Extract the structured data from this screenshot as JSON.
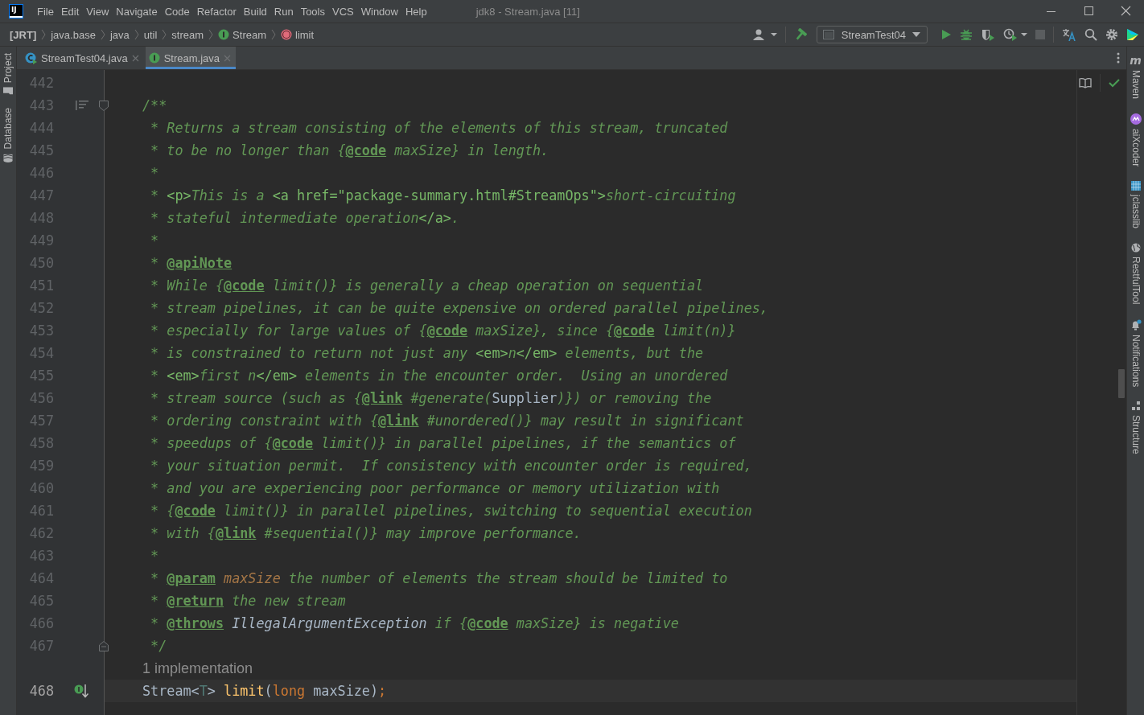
{
  "window": {
    "logo": "IJ",
    "title": "jdk8 - Stream.java [11]"
  },
  "menu": [
    "File",
    "Edit",
    "View",
    "Navigate",
    "Code",
    "Refactor",
    "Build",
    "Run",
    "Tools",
    "VCS",
    "Window",
    "Help"
  ],
  "breadcrumbs": [
    {
      "label": "[JRT]",
      "kind": "root"
    },
    {
      "label": "java.base",
      "kind": "package"
    },
    {
      "label": "java",
      "kind": "package"
    },
    {
      "label": "util",
      "kind": "package"
    },
    {
      "label": "stream",
      "kind": "package"
    },
    {
      "label": "Stream",
      "kind": "interface"
    },
    {
      "label": "limit",
      "kind": "method"
    }
  ],
  "run_configuration": {
    "label": "StreamTest04"
  },
  "tabs": [
    {
      "label": "StreamTest04.java",
      "kind": "class",
      "selected": false
    },
    {
      "label": "Stream.java",
      "kind": "interface",
      "selected": true
    }
  ],
  "left_tool_windows": [
    {
      "label": "Project",
      "kind": "folder"
    },
    {
      "label": "Database",
      "kind": "database"
    }
  ],
  "right_tool_windows": [
    {
      "label": "Maven",
      "kind": "maven",
      "glyph": "m"
    },
    {
      "label": "aiXcoder",
      "kind": "aixcoder"
    },
    {
      "label": "jclasslib",
      "kind": "jclasslib"
    },
    {
      "label": "RestfulTool",
      "kind": "globe"
    },
    {
      "label": "Notifications",
      "kind": "notifications"
    },
    {
      "label": "Structure",
      "kind": "structure"
    }
  ],
  "editor": {
    "lines": [
      {
        "kind": "code",
        "number": "442",
        "current": false
      },
      {
        "kind": "code",
        "number": "443",
        "current": false,
        "doc_toggle": true,
        "fold_start": true,
        "segments": [
          {
            "kind": "text",
            "text": "/**"
          }
        ]
      },
      {
        "kind": "code",
        "number": "444",
        "current": false,
        "segments": [
          {
            "kind": "text",
            "text": " * Returns a stream consisting of the elements of this stream, truncated"
          }
        ]
      },
      {
        "kind": "code",
        "number": "445",
        "current": false,
        "segments": [
          {
            "kind": "text",
            "text": " * to be no longer than {"
          },
          {
            "kind": "tag",
            "text": "@code"
          },
          {
            "kind": "text",
            "text": " maxSize} in length."
          }
        ]
      },
      {
        "kind": "code",
        "number": "446",
        "current": false,
        "segments": [
          {
            "kind": "text",
            "text": " *"
          }
        ]
      },
      {
        "kind": "code",
        "number": "447",
        "current": false,
        "segments": [
          {
            "kind": "text",
            "text": " * "
          },
          {
            "kind": "markup",
            "text": "<p>"
          },
          {
            "kind": "text",
            "text": "This is a "
          },
          {
            "kind": "markup",
            "text": "<a href=\"package-summary.html#StreamOps\">"
          },
          {
            "kind": "text",
            "text": "short-circuiting"
          }
        ]
      },
      {
        "kind": "code",
        "number": "448",
        "current": false,
        "segments": [
          {
            "kind": "text",
            "text": " * stateful intermediate operation"
          },
          {
            "kind": "markup",
            "text": "</a>"
          },
          {
            "kind": "text",
            "text": "."
          }
        ]
      },
      {
        "kind": "code",
        "number": "449",
        "current": false,
        "segments": [
          {
            "kind": "text",
            "text": " *"
          }
        ]
      },
      {
        "kind": "code",
        "number": "450",
        "current": false,
        "segments": [
          {
            "kind": "text",
            "text": " * "
          },
          {
            "kind": "tag",
            "text": "@apiNote"
          }
        ]
      },
      {
        "kind": "code",
        "number": "451",
        "current": false,
        "segments": [
          {
            "kind": "text",
            "text": " * While {"
          },
          {
            "kind": "tag",
            "text": "@code"
          },
          {
            "kind": "text",
            "text": " limit()} is generally a cheap operation on sequential"
          }
        ]
      },
      {
        "kind": "code",
        "number": "452",
        "current": false,
        "segments": [
          {
            "kind": "text",
            "text": " * stream pipelines, it can be quite expensive on ordered parallel pipelines,"
          }
        ]
      },
      {
        "kind": "code",
        "number": "453",
        "current": false,
        "segments": [
          {
            "kind": "text",
            "text": " * especially for large values of {"
          },
          {
            "kind": "tag",
            "text": "@code"
          },
          {
            "kind": "text",
            "text": " maxSize}, since {"
          },
          {
            "kind": "tag",
            "text": "@code"
          },
          {
            "kind": "text",
            "text": " limit(n)}"
          }
        ]
      },
      {
        "kind": "code",
        "number": "454",
        "current": false,
        "segments": [
          {
            "kind": "text",
            "text": " * is constrained to return not just any "
          },
          {
            "kind": "markup",
            "text": "<em>"
          },
          {
            "kind": "text",
            "text": "n"
          },
          {
            "kind": "markup",
            "text": "</em>"
          },
          {
            "kind": "text",
            "text": " elements, but the"
          }
        ]
      },
      {
        "kind": "code",
        "number": "455",
        "current": false,
        "segments": [
          {
            "kind": "text",
            "text": " * "
          },
          {
            "kind": "markup",
            "text": "<em>"
          },
          {
            "kind": "text",
            "text": "first n"
          },
          {
            "kind": "markup",
            "text": "</em>"
          },
          {
            "kind": "text",
            "text": " elements in the encounter order.  Using an unordered"
          }
        ]
      },
      {
        "kind": "code",
        "number": "456",
        "current": false,
        "segments": [
          {
            "kind": "text",
            "text": " * stream source (such as {"
          },
          {
            "kind": "tag",
            "text": "@link"
          },
          {
            "kind": "text",
            "text": " #generate("
          },
          {
            "kind": "type",
            "text": "Supplier"
          },
          {
            "kind": "text",
            "text": ")}) or removing the"
          }
        ]
      },
      {
        "kind": "code",
        "number": "457",
        "current": false,
        "segments": [
          {
            "kind": "text",
            "text": " * ordering constraint with {"
          },
          {
            "kind": "tag",
            "text": "@link"
          },
          {
            "kind": "text",
            "text": " #unordered()} may result in significant"
          }
        ]
      },
      {
        "kind": "code",
        "number": "458",
        "current": false,
        "segments": [
          {
            "kind": "text",
            "text": " * speedups of {"
          },
          {
            "kind": "tag",
            "text": "@code"
          },
          {
            "kind": "text",
            "text": " limit()} in parallel pipelines, if the semantics of"
          }
        ]
      },
      {
        "kind": "code",
        "number": "459",
        "current": false,
        "segments": [
          {
            "kind": "text",
            "text": " * your situation permit.  If consistency with encounter order is required,"
          }
        ]
      },
      {
        "kind": "code",
        "number": "460",
        "current": false,
        "segments": [
          {
            "kind": "text",
            "text": " * and you are experiencing poor performance or memory utilization with"
          }
        ]
      },
      {
        "kind": "code",
        "number": "461",
        "current": false,
        "segments": [
          {
            "kind": "text",
            "text": " * {"
          },
          {
            "kind": "tag",
            "text": "@code"
          },
          {
            "kind": "text",
            "text": " limit()} in parallel pipelines, switching to sequential execution"
          }
        ]
      },
      {
        "kind": "code",
        "number": "462",
        "current": false,
        "segments": [
          {
            "kind": "text",
            "text": " * with {"
          },
          {
            "kind": "tag",
            "text": "@link"
          },
          {
            "kind": "text",
            "text": " #sequential()} may improve performance."
          }
        ]
      },
      {
        "kind": "code",
        "number": "463",
        "current": false,
        "segments": [
          {
            "kind": "text",
            "text": " *"
          }
        ]
      },
      {
        "kind": "code",
        "number": "464",
        "current": false,
        "segments": [
          {
            "kind": "text",
            "text": " * "
          },
          {
            "kind": "tag",
            "text": "@param"
          },
          {
            "kind": "parameter",
            "text": " maxSize"
          },
          {
            "kind": "text",
            "text": " the number of elements the stream should be limited to"
          }
        ]
      },
      {
        "kind": "code",
        "number": "465",
        "current": false,
        "segments": [
          {
            "kind": "text",
            "text": " * "
          },
          {
            "kind": "tag",
            "text": "@return"
          },
          {
            "kind": "text",
            "text": " the new stream"
          }
        ]
      },
      {
        "kind": "code",
        "number": "466",
        "current": false,
        "segments": [
          {
            "kind": "text",
            "text": " * "
          },
          {
            "kind": "tag",
            "text": "@throws"
          },
          {
            "kind": "exception",
            "text": " IllegalArgumentException"
          },
          {
            "kind": "text",
            "text": " if {"
          },
          {
            "kind": "tag",
            "text": "@code"
          },
          {
            "kind": "text",
            "text": " maxSize} is negative"
          }
        ]
      },
      {
        "kind": "code",
        "number": "467",
        "current": false,
        "fold_end": true,
        "segments": [
          {
            "kind": "text",
            "text": " */"
          }
        ]
      },
      {
        "kind": "inlay",
        "text": "1 implementation"
      },
      {
        "kind": "code",
        "number": "468",
        "current": true,
        "implemented": true,
        "segments": [
          {
            "kind": "plain",
            "text": "Stream<"
          },
          {
            "kind": "type_parameter",
            "text": "T"
          },
          {
            "kind": "plain",
            "text": "> "
          },
          {
            "kind": "method",
            "text": "limit"
          },
          {
            "kind": "plain",
            "text": "("
          },
          {
            "kind": "keyword",
            "text": "long"
          },
          {
            "kind": "plain",
            "text": " maxSize)"
          },
          {
            "kind": "keyword",
            "text": ";"
          }
        ]
      }
    ]
  }
}
